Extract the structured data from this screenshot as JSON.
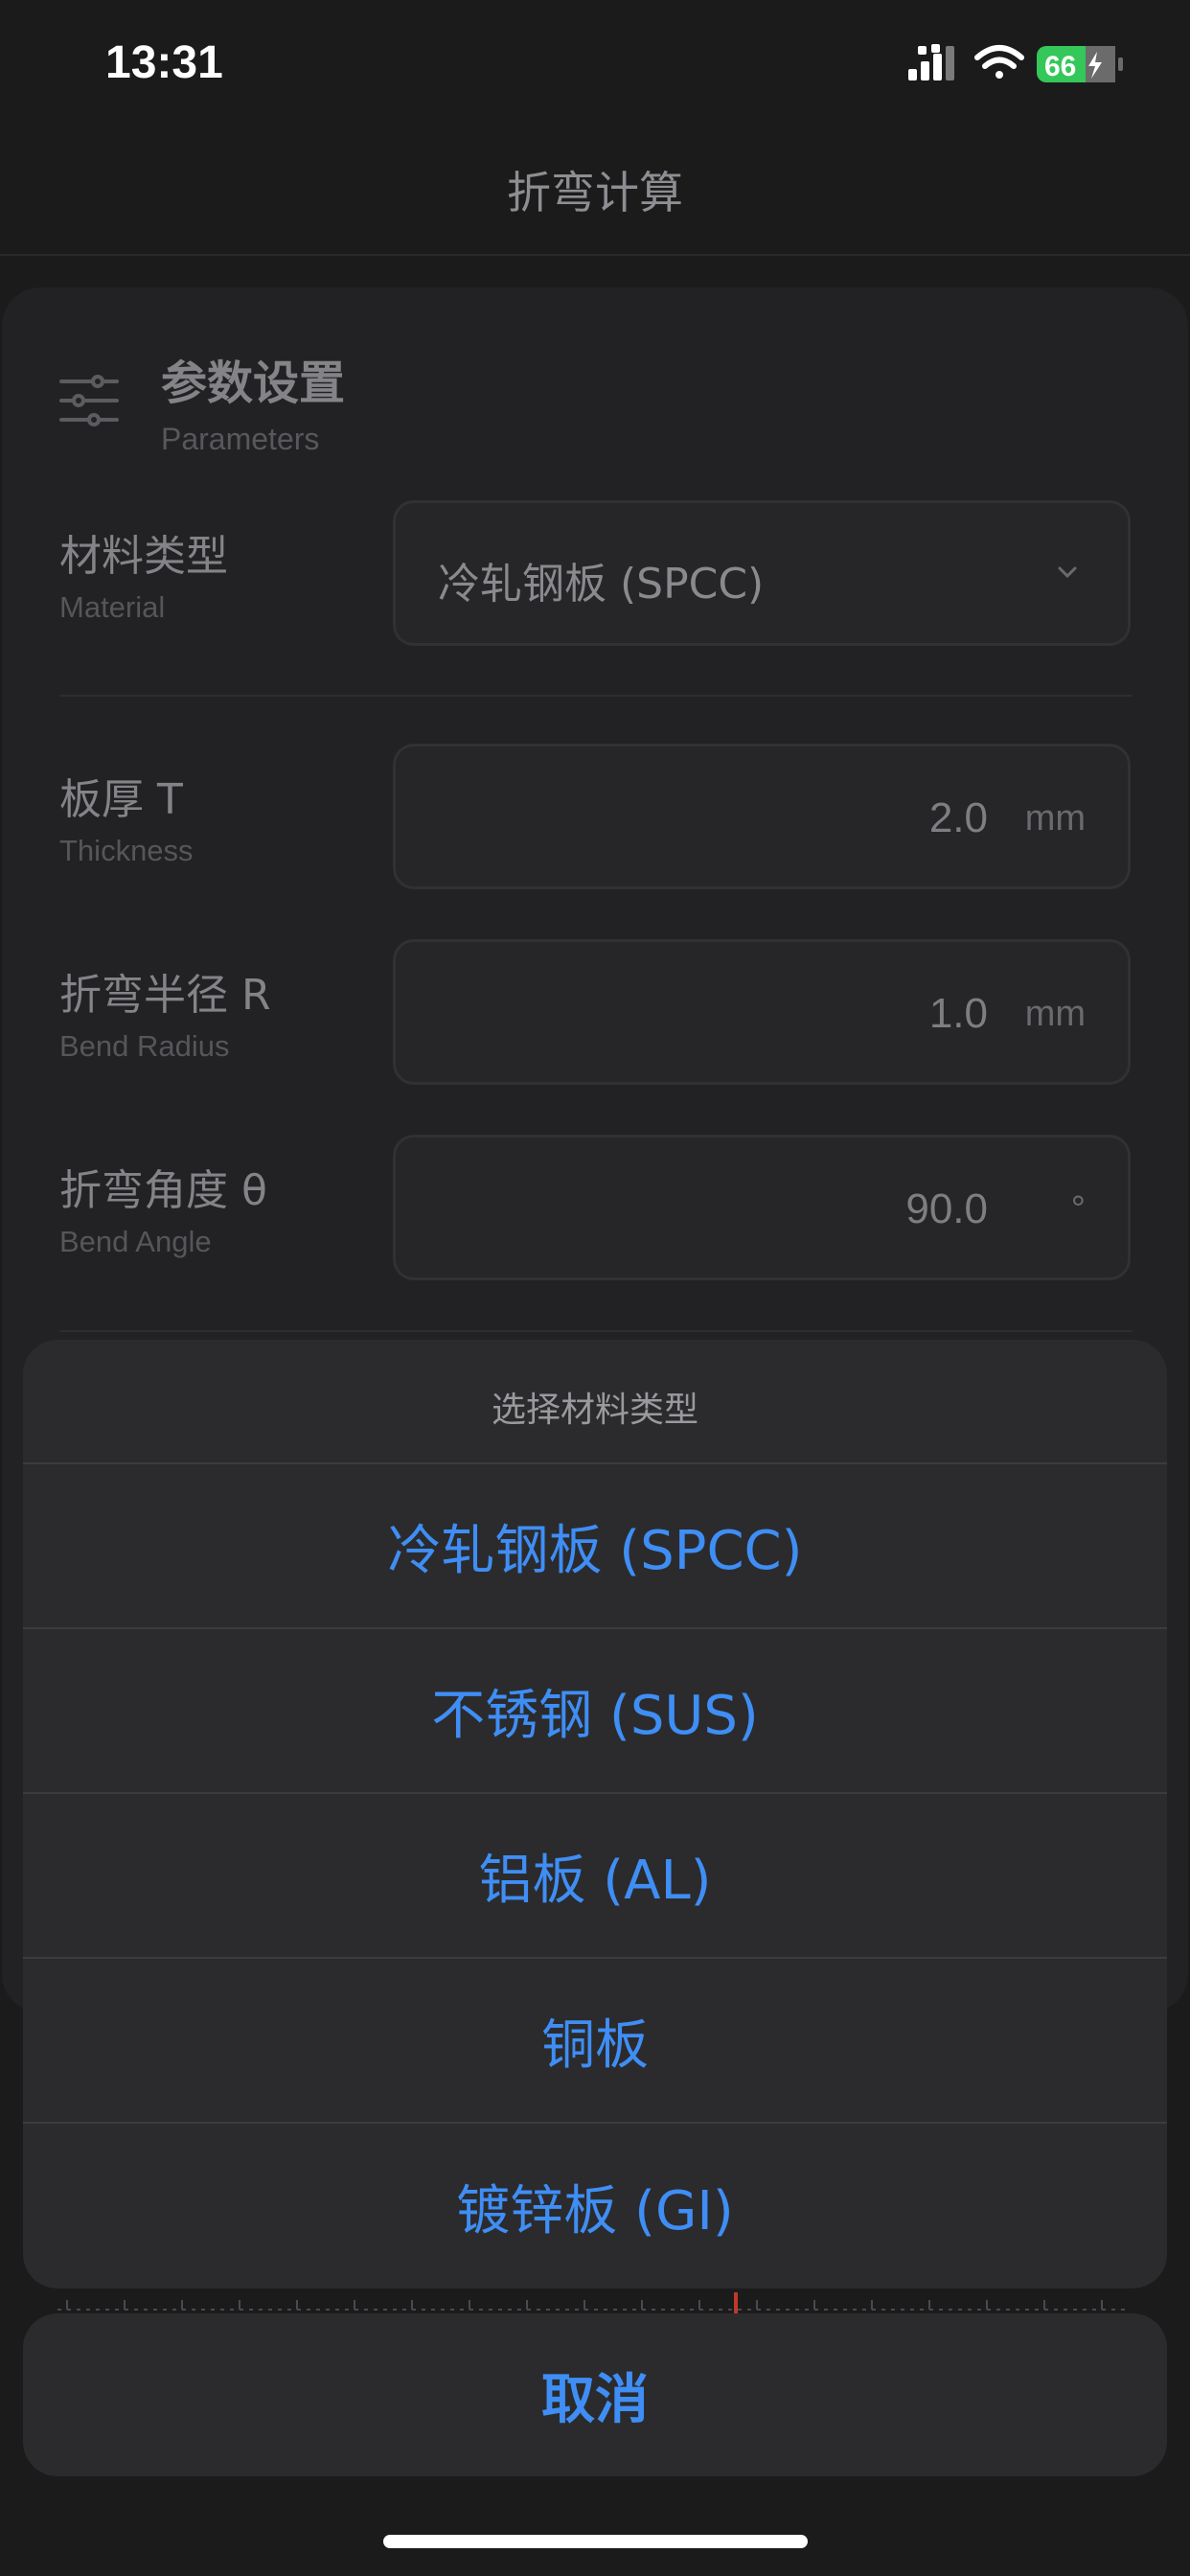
{
  "status_bar": {
    "time": "13:31",
    "battery_level": "66",
    "battery_color": "#34c759",
    "icons": [
      "signal-icon",
      "wifi-icon",
      "battery-icon"
    ]
  },
  "nav": {
    "title": "折弯计算"
  },
  "card": {
    "icon": "sliders-icon",
    "title": "参数设置",
    "subtitle": "Parameters",
    "material": {
      "label": "材料类型",
      "sub": "Material",
      "value": "冷轧钢板 (SPCC)"
    },
    "thickness": {
      "label": "板厚 T",
      "sub": "Thickness",
      "value": "2.0",
      "unit": "mm"
    },
    "radius": {
      "label": "折弯半径 R",
      "sub": "Bend Radius",
      "value": "1.0",
      "unit": "mm"
    },
    "angle": {
      "label": "折弯角度 θ",
      "sub": "Bend Angle",
      "value": "90.0",
      "unit": "°"
    }
  },
  "action_sheet": {
    "title": "选择材料类型",
    "options": [
      "冷轧钢板 (SPCC)",
      "不锈钢 (SUS)",
      "铝板 (AL)",
      "铜板",
      "镀锌板 (GI)"
    ],
    "cancel": "取消",
    "accent_color": "#3f8ef5"
  }
}
